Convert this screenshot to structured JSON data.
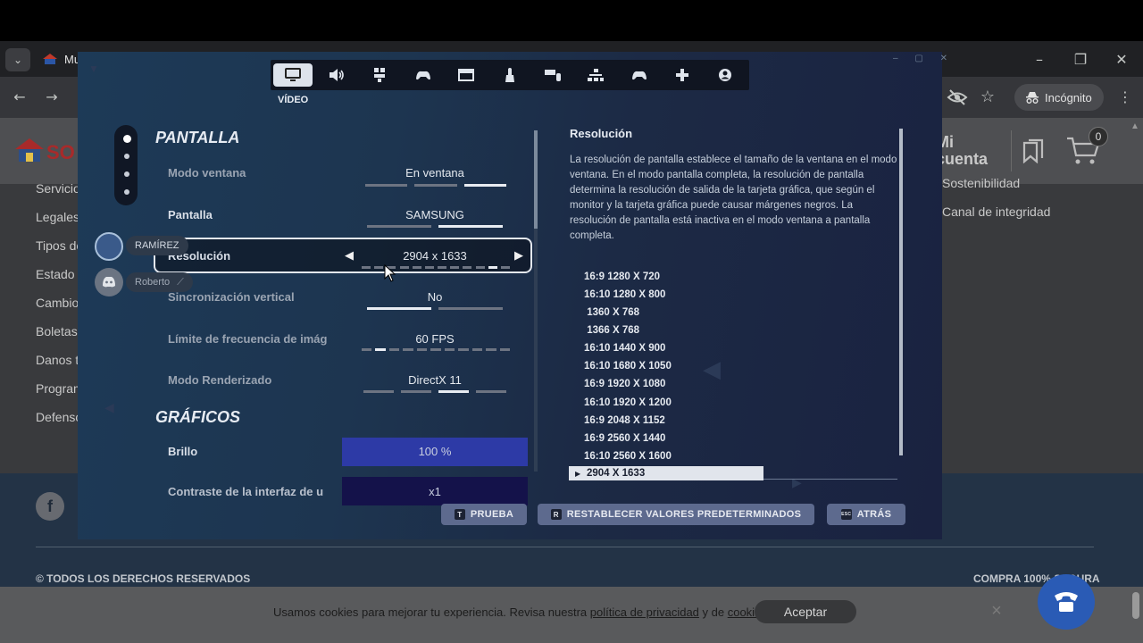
{
  "browser": {
    "tab_title": "Mu",
    "incognito_label": "Incógnito"
  },
  "site": {
    "logo_text": "SO",
    "left_links": [
      "Servicio",
      "Legales",
      "Tipos de",
      "Estado d",
      "Cambio",
      "Boletas",
      "Danos t",
      "Program",
      "Defenso"
    ],
    "right_links": [
      "Sostenibilidad",
      "Canal de integridad"
    ],
    "account_line1": "Mi",
    "account_line2": "cuenta",
    "cart_count": "0",
    "facebook_glyph": "f",
    "copyright": "© TODOS LOS DERECHOS RESERVADOS",
    "compra": "COMPRA 100% SEGURA",
    "cookie": {
      "text_before": "Usamos cookies para mejorar tu experiencia. Revisa nuestra ",
      "privacy_link": "política de privacidad",
      "text_mid": " y de ",
      "cookies_link": "cookies",
      "accept": "Aceptar"
    }
  },
  "game": {
    "category_label": "VÍDEO",
    "sections": {
      "pantalla": "PANTALLA",
      "graficos": "GRÁFICOS"
    },
    "rows": [
      {
        "label": "Modo ventana",
        "value": "En ventana",
        "segments": 3,
        "active_segment": 3
      },
      {
        "label": "Pantalla",
        "value": "SAMSUNG",
        "segments": 2,
        "active_segment": 2
      },
      {
        "label": "Resolución",
        "value": "2904 x 1633",
        "segments": 12,
        "active_segment": 11
      },
      {
        "label": "Sincronización vertical",
        "value": "No",
        "segments": 2,
        "active_segment": 1
      },
      {
        "label": "Límite de frecuencia de imág",
        "value": "60 FPS",
        "segments": 11,
        "active_segment": 2
      },
      {
        "label": "Modo Renderizado",
        "value": "DirectX 11",
        "segments": 4,
        "active_segment": 3
      }
    ],
    "brillo": {
      "label": "Brillo",
      "value": "100 %",
      "fraction": 1.0
    },
    "contraste": {
      "label": "Contraste de la interfaz de u",
      "value": "x1"
    },
    "description": {
      "title": "Resolución",
      "text": "La resolución de pantalla establece el tamaño de la ventana en el modo ventana. En el modo pantalla completa, la resolución de pantalla determina la resolución de salida de la tarjeta gráfica, que según el monitor y la tarjeta gráfica puede causar márgenes negros. La resolución de pantalla está inactiva en el modo ventana a pantalla completa."
    },
    "resolution_options": [
      "16:9 1280 X 720",
      "16:10 1280 X 800",
      " 1360 X 768",
      " 1366 X 768",
      "16:10 1440 X 900",
      "16:10 1680 X 1050",
      "16:9 1920 X 1080",
      "16:10 1920 X 1200",
      "16:9 2048 X 1152",
      "16:9 2560 X 1440",
      "16:10 2560 X 1600"
    ],
    "resolution_selected": "2904 X 1633",
    "buttons": {
      "test_key": "T",
      "test": "PRUEBA",
      "reset_key": "R",
      "reset": "RESTABLECER VALORES PREDETERMINADOS",
      "back_key": "ESC",
      "back": "ATRÁS"
    },
    "users": [
      {
        "name": "RAMÍREZ"
      },
      {
        "name": "Roberto"
      }
    ],
    "icons": [
      "monitor-icon",
      "speaker-icon",
      "controller-settings-icon",
      "gamepad-mouse-icon",
      "window-icon",
      "touch-icon",
      "keyboard-mouse-icon",
      "network-icon",
      "gamepad-icon",
      "dpad-icon",
      "account-icon"
    ]
  },
  "colors": {
    "game_bg": "#1d3a57",
    "accent_blue": "#2d3aa6",
    "button_bg": "#5d6a8e"
  }
}
